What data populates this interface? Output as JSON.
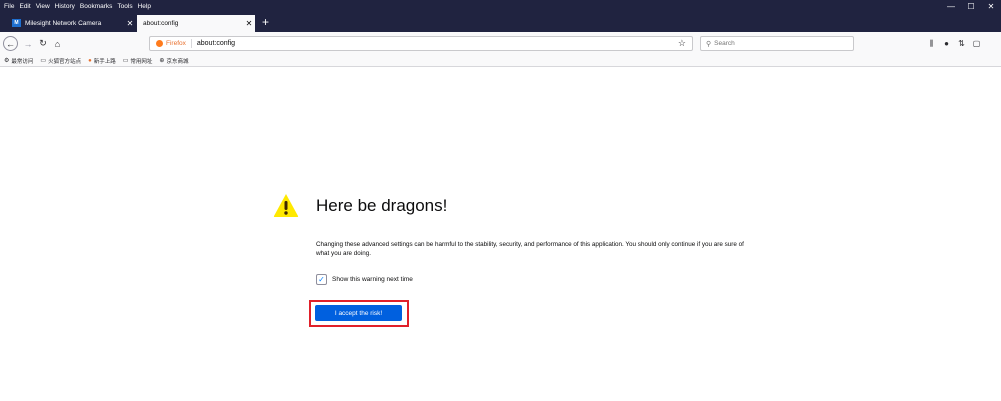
{
  "menubar": {
    "items": [
      "File",
      "Edit",
      "View",
      "History",
      "Bookmarks",
      "Tools",
      "Help"
    ]
  },
  "window_controls": {
    "minimize": "—",
    "maximize": "☐",
    "close": "✕"
  },
  "tabs": [
    {
      "title": "Milesight Network Camera",
      "favicon": "M",
      "active": false
    },
    {
      "title": "about:config",
      "active": true
    }
  ],
  "navbar": {
    "identity_label": "Firefox",
    "url": "about:config",
    "search_placeholder": "Search"
  },
  "bookmarks": [
    {
      "icon": "gear-icon",
      "label": "最常访问"
    },
    {
      "icon": "folder-icon",
      "label": "火狐官方站点"
    },
    {
      "icon": "firefox-icon",
      "label": "新手上路"
    },
    {
      "icon": "folder-icon",
      "label": "常用网址"
    },
    {
      "icon": "globe-icon",
      "label": "京东商城"
    }
  ],
  "page": {
    "heading": "Here be dragons!",
    "description": "Changing these advanced settings can be harmful to the stability, security, and performance of this application. You should only continue if you are sure of what you are doing.",
    "checkbox_label": "Show this warning next time",
    "checkbox_checked": true,
    "accept_button": "I accept the risk!"
  },
  "colors": {
    "chrome_dark": "#202340",
    "toolbar": "#f9f9fa",
    "accent_blue": "#0060df",
    "warning_yellow": "#ffe900",
    "highlight_red": "#e0202a"
  }
}
